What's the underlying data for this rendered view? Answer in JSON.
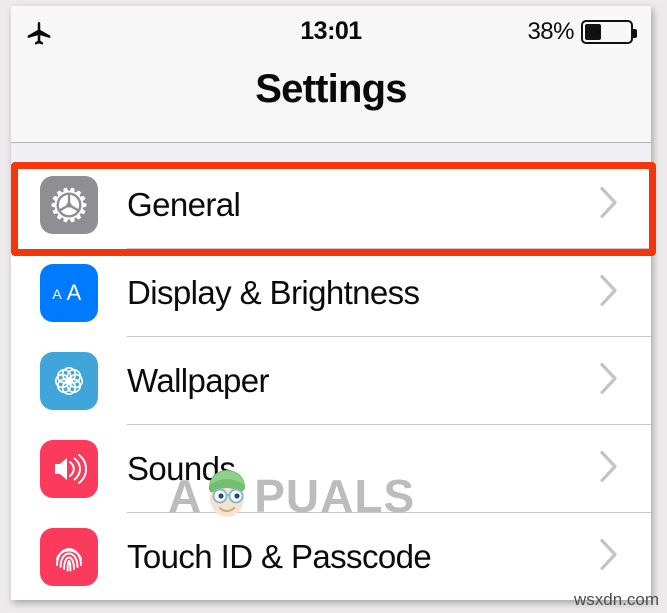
{
  "status_bar": {
    "airplane_icon": "airplane-icon",
    "time": "13:01",
    "battery_percent_label": "38%",
    "battery_level": 38,
    "battery_icon": "battery-icon"
  },
  "nav": {
    "title": "Settings"
  },
  "list": {
    "rows": [
      {
        "label": "General",
        "icon": "gear-icon",
        "icon_color": "#8E8E93",
        "chevron": "chevron-right-icon",
        "highlighted": true
      },
      {
        "label": "Display & Brightness",
        "icon": "text-size-aa-icon",
        "icon_color": "#007AFF",
        "chevron": "chevron-right-icon",
        "highlighted": false
      },
      {
        "label": "Wallpaper",
        "icon": "flower-rosette-icon",
        "icon_color": "#40A5D8",
        "chevron": "chevron-right-icon",
        "highlighted": false
      },
      {
        "label": "Sounds",
        "icon": "speaker-volume-icon",
        "icon_color": "#FB3B5C",
        "chevron": "chevron-right-icon",
        "highlighted": false
      },
      {
        "label": "Touch ID & Passcode",
        "icon": "fingerprint-icon",
        "icon_color": "#FB3B5C",
        "chevron": "chevron-right-icon",
        "highlighted": false
      }
    ]
  },
  "annotation": {
    "highlight_color": "#F5350B",
    "highlight_target": "General"
  },
  "watermarks": {
    "brand": "PUALS",
    "brand_first_letter": "A",
    "brand_full": "APPUALS",
    "domain": "wsxdn.com"
  }
}
